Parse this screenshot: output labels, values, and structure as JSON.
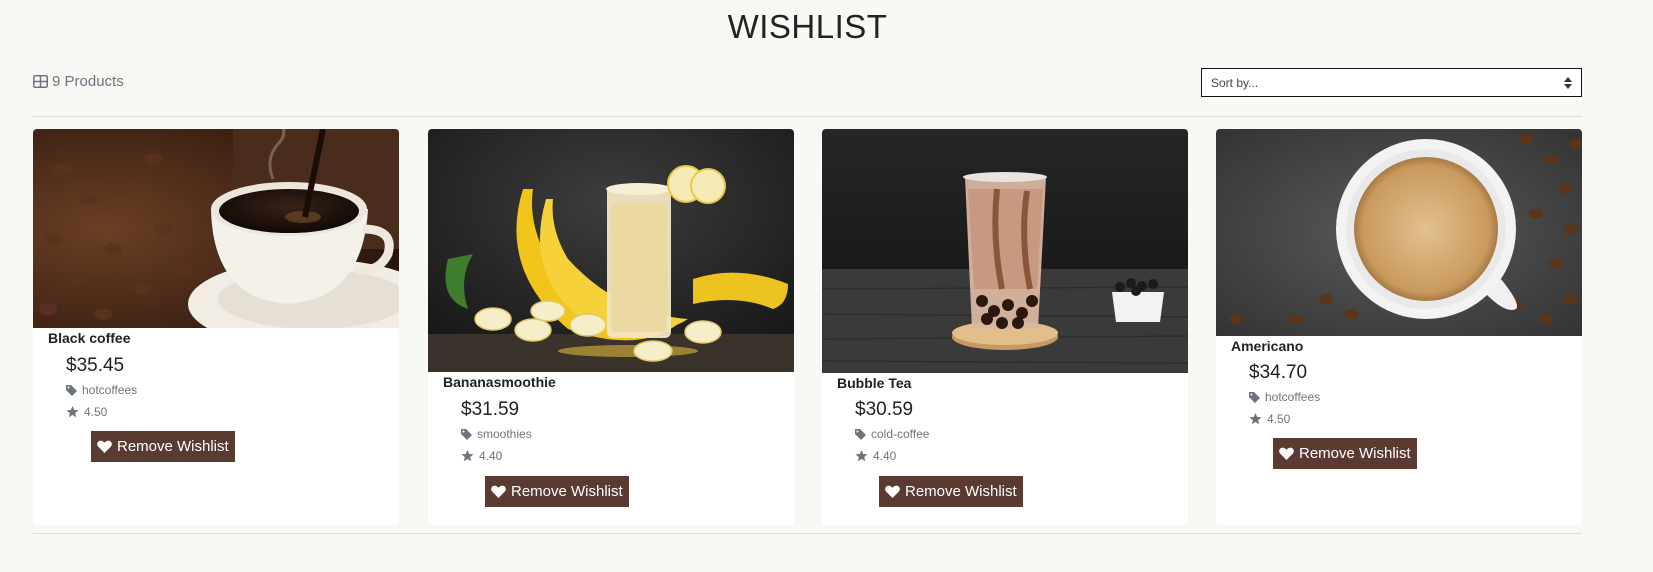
{
  "header": {
    "title": "WISHLIST"
  },
  "toolbar": {
    "product_count": "9 Products",
    "sort_placeholder": "Sort by..."
  },
  "products": [
    {
      "name": "Black coffee",
      "price": "$35.45",
      "category": "hotcoffees",
      "rating": "4.50",
      "button_label": "Remove Wishlist"
    },
    {
      "name": "Bananasmoothie",
      "price": "$31.59",
      "category": "smoothies",
      "rating": "4.40",
      "button_label": "Remove Wishlist"
    },
    {
      "name": "Bubble Tea",
      "price": "$30.59",
      "category": "cold-coffee",
      "rating": "4.40",
      "button_label": "Remove Wishlist"
    },
    {
      "name": "Americano",
      "price": "$34.70",
      "category": "hotcoffees",
      "rating": "4.50",
      "button_label": "Remove Wishlist"
    }
  ],
  "colors": {
    "button": "#5a3b32",
    "page_bg": "#f8f8f5",
    "muted": "#6c757d"
  },
  "icons": {
    "count": "grid-icon",
    "sort": "sort-arrows-icon",
    "category": "tag-icon",
    "rating": "star-icon",
    "remove": "heart-icon"
  }
}
